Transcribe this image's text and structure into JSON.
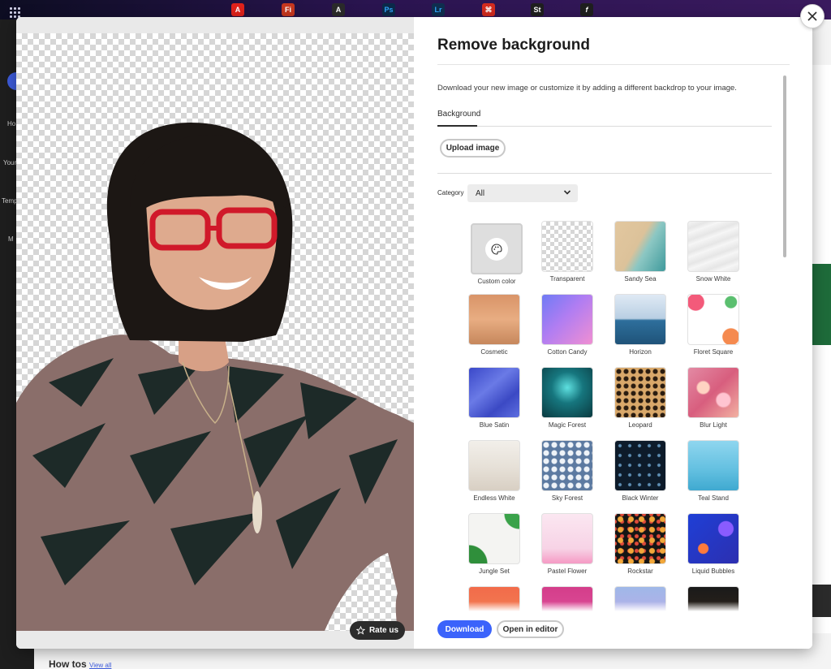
{
  "topbar": {
    "apps": [
      {
        "icon": "adobe-acrobat-icon",
        "letter": "A",
        "color": "#e0221b"
      },
      {
        "icon": "adobe-fresco-icon",
        "letter": "Fi",
        "color": "#c7381f"
      },
      {
        "icon": "adobe-express-icon",
        "letter": "A",
        "color": "#2b2b2b"
      },
      {
        "icon": "adobe-photoshop-icon",
        "letter": "Ps",
        "color": "#0b2a4a"
      },
      {
        "icon": "adobe-lightroom-icon",
        "letter": "Lr",
        "color": "#0f2f4f"
      },
      {
        "icon": "adobe-acrobat-pdf-icon",
        "letter": "⌘",
        "color": "#d32b1f"
      },
      {
        "icon": "adobe-stock-icon",
        "letter": "St",
        "color": "#1f1f1f"
      },
      {
        "icon": "adobe-fonts-icon",
        "letter": "f",
        "color": "#1f1f1f"
      }
    ]
  },
  "background_app": {
    "sidebar_items": [
      "Ho",
      "Your",
      "Temp",
      "M"
    ],
    "howtos_title": "How tos",
    "view_all": "View all"
  },
  "modal": {
    "rate_us": "Rate us",
    "title": "Remove background",
    "description": "Download your new image or customize it by adding a different backdrop to your image.",
    "tab": "Background",
    "upload_button": "Upload image",
    "category_label": "Category",
    "category_value": "All",
    "backgrounds": [
      {
        "label": "Custom color"
      },
      {
        "label": "Transparent"
      },
      {
        "label": "Sandy Sea"
      },
      {
        "label": "Snow White"
      },
      {
        "label": "Cosmetic"
      },
      {
        "label": "Cotton Candy"
      },
      {
        "label": "Horizon"
      },
      {
        "label": "Floret Square"
      },
      {
        "label": "Blue Satin"
      },
      {
        "label": "Magic Forest"
      },
      {
        "label": "Leopard"
      },
      {
        "label": "Blur Light"
      },
      {
        "label": "Endless White"
      },
      {
        "label": "Sky Forest"
      },
      {
        "label": "Black Winter"
      },
      {
        "label": "Teal Stand"
      },
      {
        "label": "Jungle Set"
      },
      {
        "label": "Pastel Flower"
      },
      {
        "label": "Rockstar"
      },
      {
        "label": "Liquid Bubbles"
      }
    ],
    "download_button": "Download",
    "open_in_editor_button": "Open in editor"
  },
  "colors": {
    "accent": "#3b63fb",
    "topbar": "#2a1450",
    "dark_button": "#2c2c2c"
  }
}
